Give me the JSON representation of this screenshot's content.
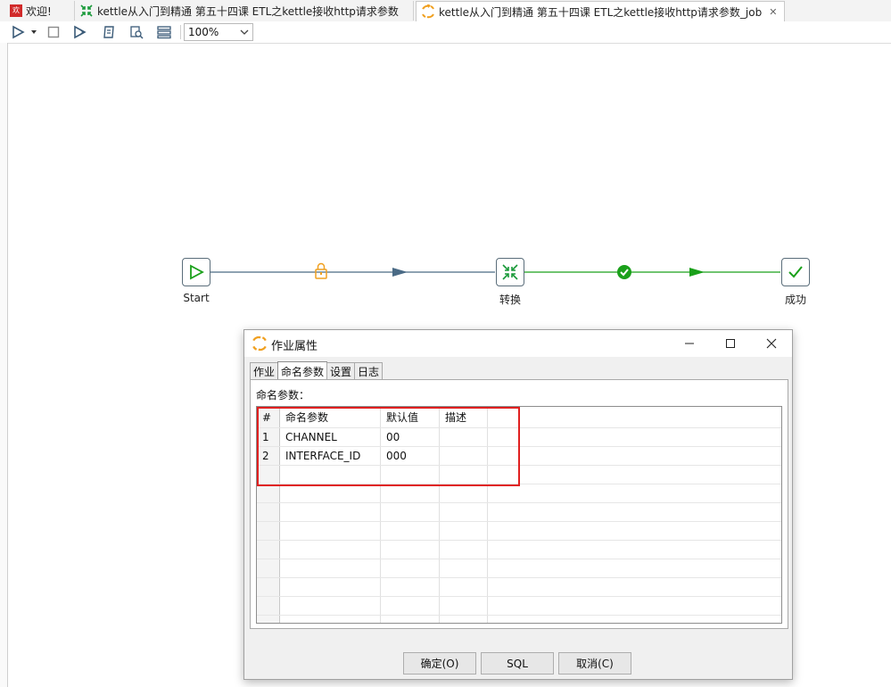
{
  "tabs": [
    {
      "label": "欢迎!",
      "icon": "welcome-icon",
      "active": false
    },
    {
      "label": "kettle从入门到精通 第五十四课 ETL之kettle接收http请求参数",
      "icon": "transformation-icon",
      "active": false
    },
    {
      "label": "kettle从入门到精通 第五十四课 ETL之kettle接收http请求参数_job",
      "icon": "job-icon",
      "active": true
    }
  ],
  "toolbar": {
    "zoom": "100%"
  },
  "canvas": {
    "nodes": {
      "start": "Start",
      "transform": "转换",
      "success": "成功"
    }
  },
  "dialog": {
    "title": "作业属性",
    "tabs": [
      "作业",
      "命名参数",
      "设置",
      "日志"
    ],
    "active_tab": "命名参数",
    "section_label": "命名参数：",
    "columns": [
      "#",
      "命名参数",
      "默认值",
      "描述"
    ],
    "rows": [
      {
        "num": "1",
        "name": "CHANNEL",
        "default": "00",
        "desc": ""
      },
      {
        "num": "2",
        "name": "INTERFACE_ID",
        "default": "000",
        "desc": ""
      }
    ],
    "buttons": {
      "ok": "确定(O)",
      "sql": "SQL",
      "cancel": "取消(C)"
    }
  },
  "colors": {
    "green": "#1aa01a",
    "hop_blue": "#4a6a85",
    "lock_orange": "#f0a020",
    "highlight_red": "#e02020"
  }
}
